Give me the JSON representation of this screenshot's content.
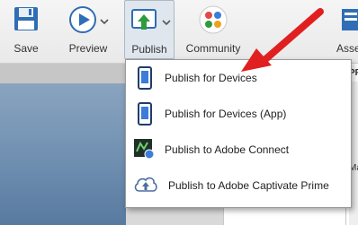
{
  "toolbar": {
    "save_label": "Save",
    "preview_label": "Preview",
    "publish_label": "Publish",
    "community_label": "Community",
    "assets_label": "Asse"
  },
  "panel": {
    "tab_pr": "PR",
    "tab_ma": "Ma"
  },
  "publish_menu": {
    "items": [
      {
        "label": "Publish for Devices",
        "icon": "phone-icon"
      },
      {
        "label": "Publish for Devices (App)",
        "icon": "phone-icon"
      },
      {
        "label": "Publish to Adobe Connect",
        "icon": "adobe-connect-icon"
      },
      {
        "label": "Publish to Adobe Captivate Prime",
        "icon": "cloud-upload-icon"
      }
    ]
  },
  "colors": {
    "accent_blue": "#2f6db5",
    "publish_green": "#2e9b3d",
    "arrow_red": "#e02020"
  }
}
